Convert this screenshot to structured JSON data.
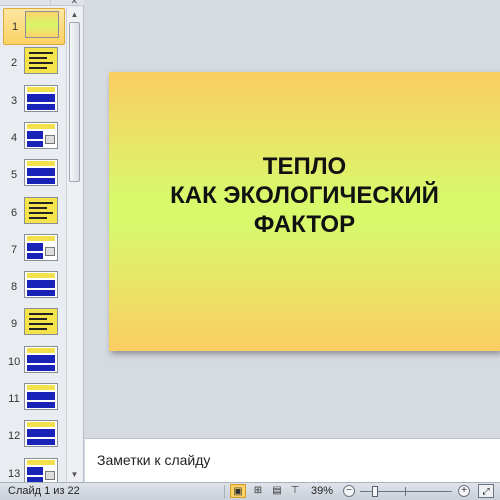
{
  "slide": {
    "title_lines": [
      "ТЕПЛО",
      "КАК ЭКОЛОГИЧЕСКИЙ",
      "ФАКТОР"
    ],
    "background_colors": [
      "#fbcd62",
      "#d9f86c"
    ]
  },
  "thumbnails": [
    {
      "num": "1",
      "style": "green",
      "selected": true
    },
    {
      "num": "2",
      "style": "yellow"
    },
    {
      "num": "3",
      "style": "blue"
    },
    {
      "num": "4",
      "style": "blue-pic"
    },
    {
      "num": "5",
      "style": "blue"
    },
    {
      "num": "6",
      "style": "yellow"
    },
    {
      "num": "7",
      "style": "blue-pic"
    },
    {
      "num": "8",
      "style": "blue"
    },
    {
      "num": "9",
      "style": "yellow"
    },
    {
      "num": "10",
      "style": "blue"
    },
    {
      "num": "11",
      "style": "blue"
    },
    {
      "num": "12",
      "style": "blue"
    },
    {
      "num": "13",
      "style": "blue-pic"
    }
  ],
  "notes": {
    "placeholder": "Заметки к слайду"
  },
  "status": {
    "slide_info": "Слайд 1 из 22",
    "zoom": "39%",
    "zoom_out": "−",
    "zoom_in": "+"
  },
  "colors": {
    "selection": "#fbd264",
    "accent_blue": "#1a23b8"
  }
}
